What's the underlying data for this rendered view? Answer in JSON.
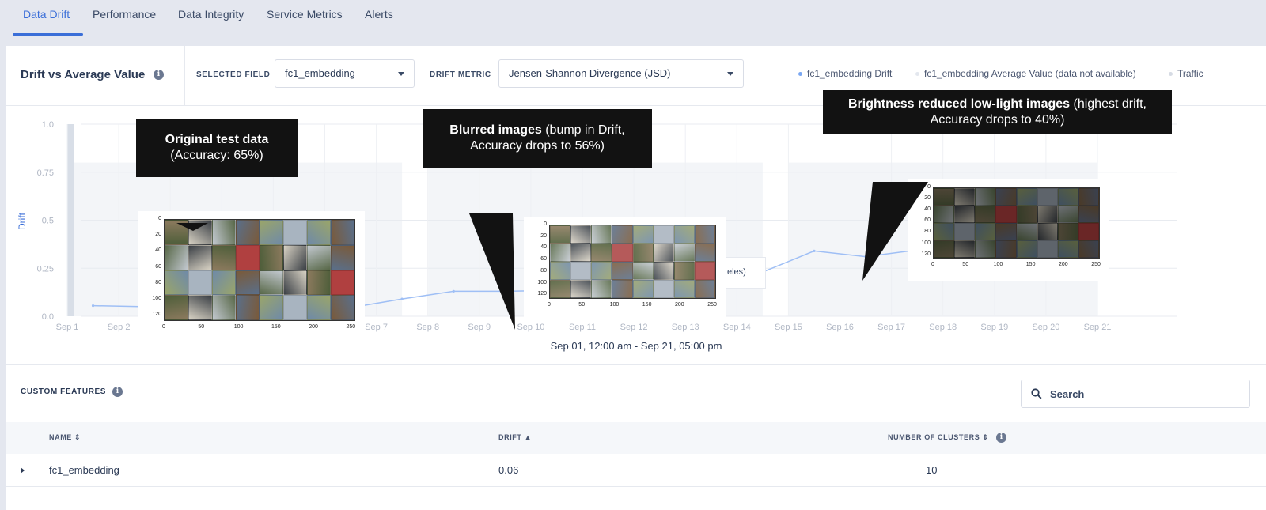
{
  "tabs": [
    {
      "label": "Data Drift",
      "active": true
    },
    {
      "label": "Performance",
      "active": false
    },
    {
      "label": "Data Integrity",
      "active": false
    },
    {
      "label": "Service Metrics",
      "active": false
    },
    {
      "label": "Alerts",
      "active": false
    }
  ],
  "card": {
    "title": "Drift vs Average Value",
    "selected_field_label": "SELECTED FIELD",
    "selected_field_value": "fc1_embedding",
    "drift_metric_label": "DRIFT METRIC",
    "drift_metric_value": "Jensen-Shannon Divergence (JSD)",
    "legend": [
      {
        "label": "fc1_embedding Drift",
        "color": "#7aa7f2"
      },
      {
        "label": "fc1_embedding Average Value (data not available)",
        "color": "#e3e7ee"
      },
      {
        "label": "Traffic",
        "color": "#d6dbe4"
      }
    ]
  },
  "chart_data": {
    "type": "line",
    "ylabel": "Drift",
    "xlabel": "",
    "ylim": [
      0,
      1
    ],
    "yticks": [
      "0.0",
      "0.25",
      "0.5",
      "0.75",
      "1.0"
    ],
    "categories": [
      "Sep 1",
      "Sep 2",
      "Sep 3",
      "Sep 4",
      "Sep 5",
      "Sep 6",
      "Sep 7",
      "Sep 8",
      "Sep 9",
      "Sep 10",
      "Sep 11",
      "Sep 12",
      "Sep 13",
      "Sep 14",
      "Sep 15",
      "Sep 16",
      "Sep 17",
      "Sep 18",
      "Sep 19",
      "Sep 20",
      "Sep 21"
    ],
    "series": [
      {
        "name": "fc1_embedding Drift",
        "color": "#9fbff5",
        "x": [
          1.5,
          2.5,
          3.5,
          4.5,
          5.5,
          6.5,
          7.5,
          8.5,
          9.5,
          10.5,
          11.5,
          12.5,
          13.5,
          14.5,
          15.5,
          16.5,
          17.5,
          18.5,
          19.5,
          20.5
        ],
        "values": [
          0.055,
          0.05,
          0.045,
          0.055,
          0.07,
          0.045,
          0.09,
          0.13,
          0.13,
          0.135,
          0.16,
          0.14,
          0.125,
          0.23,
          0.34,
          0.31,
          0.345,
          0.34,
          0.335,
          0.34
        ]
      }
    ],
    "traffic_bands": [
      [
        1.5,
        7.5
      ],
      [
        8.5,
        14.5
      ],
      [
        15.5,
        21
      ]
    ],
    "highlight_x": 12.5,
    "date_range": "Sep 01, 12:00 am - Sep 21, 05:00 pm",
    "grid": true
  },
  "annotations": [
    {
      "bold": "Original test data",
      "rest": "(Accuracy: 65%)"
    },
    {
      "bold": "Blurred images",
      "rest": " (bump in Drift, Accuracy drops to 56%)"
    },
    {
      "bold": "Brightness reduced low-light images",
      "rest": " (highest drift, Accuracy drops to 40%)"
    }
  ],
  "thumb_axes": {
    "y": [
      "0",
      "20",
      "40",
      "60",
      "80",
      "100",
      "120"
    ],
    "x": [
      "0",
      "50",
      "100",
      "150",
      "200",
      "250"
    ]
  },
  "tooltip_fragment": "eles)",
  "custom_features": {
    "title": "CUSTOM FEATURES",
    "search_placeholder": "Search",
    "columns": [
      "NAME ⇕",
      "DRIFT ▲",
      "NUMBER OF CLUSTERS ⇕"
    ],
    "rows": [
      {
        "name": "fc1_embedding",
        "drift": "0.06",
        "clusters": "10"
      }
    ]
  }
}
